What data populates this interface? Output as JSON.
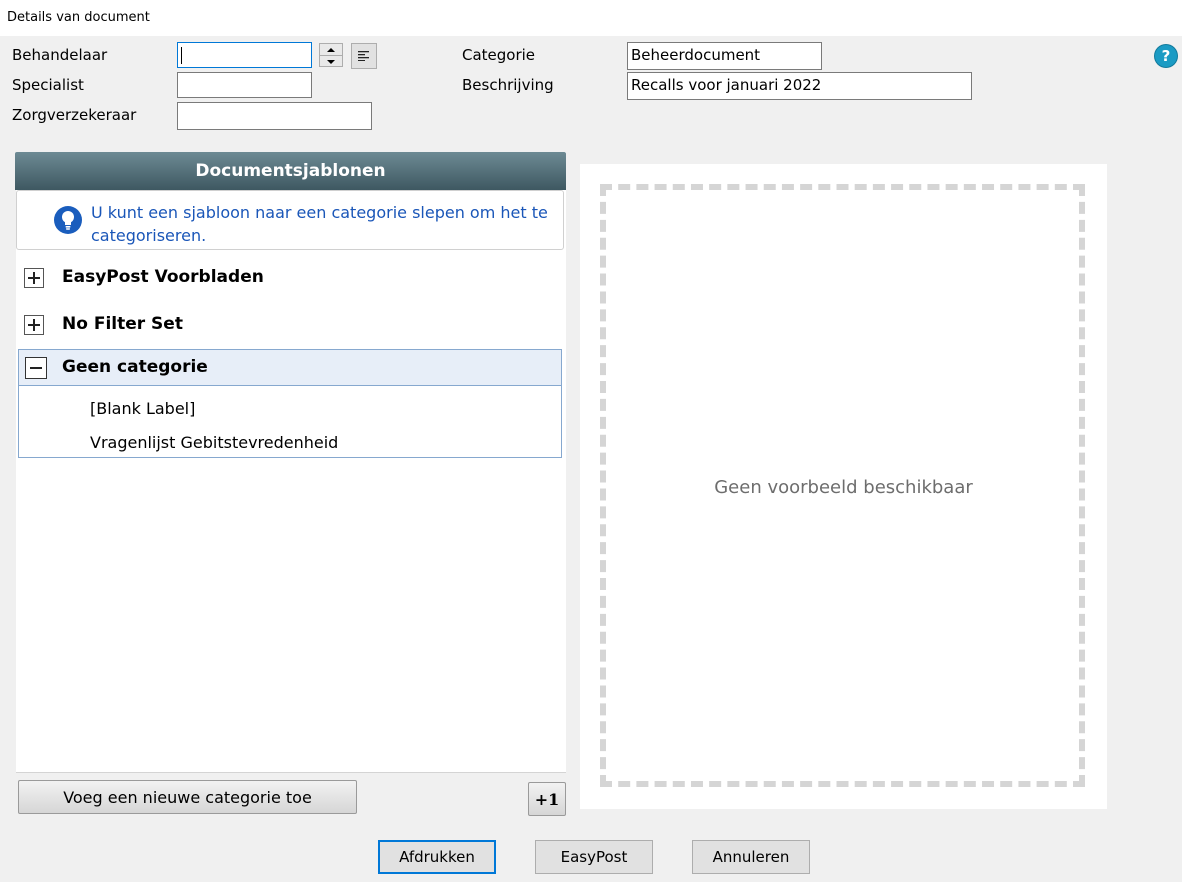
{
  "window": {
    "title": "Details van document"
  },
  "form": {
    "behandelaar_label": "Behandelaar",
    "behandelaar_value": "",
    "specialist_label": "Specialist",
    "specialist_value": "",
    "zorgverzekeraar_label": "Zorgverzekeraar",
    "zorgverzekeraar_value": "",
    "categorie_label": "Categorie",
    "categorie_value": "Beheerdocument",
    "beschrijving_label": "Beschrijving",
    "beschrijving_value": "Recalls voor januari 2022"
  },
  "help": {
    "label": "?"
  },
  "templates": {
    "header": "Documentsjablonen",
    "hint": "U kunt een sjabloon naar een categorie slepen om het te categoriseren.",
    "categories": [
      {
        "name": "EasyPost Voorbladen",
        "expanded": false
      },
      {
        "name": "No Filter Set",
        "expanded": false
      },
      {
        "name": "Geen categorie",
        "expanded": true,
        "items": [
          "[Blank Label]",
          "Vragenlijst Gebitstevredenheid"
        ]
      }
    ],
    "add_category_label": "Voeg een nieuwe categorie toe",
    "plus_one_label": "+1"
  },
  "preview": {
    "message": "Geen voorbeeld beschikbaar"
  },
  "actions": {
    "print_label": "Afdrukken",
    "easypost_label": "EasyPost",
    "cancel_label": "Annuleren"
  }
}
